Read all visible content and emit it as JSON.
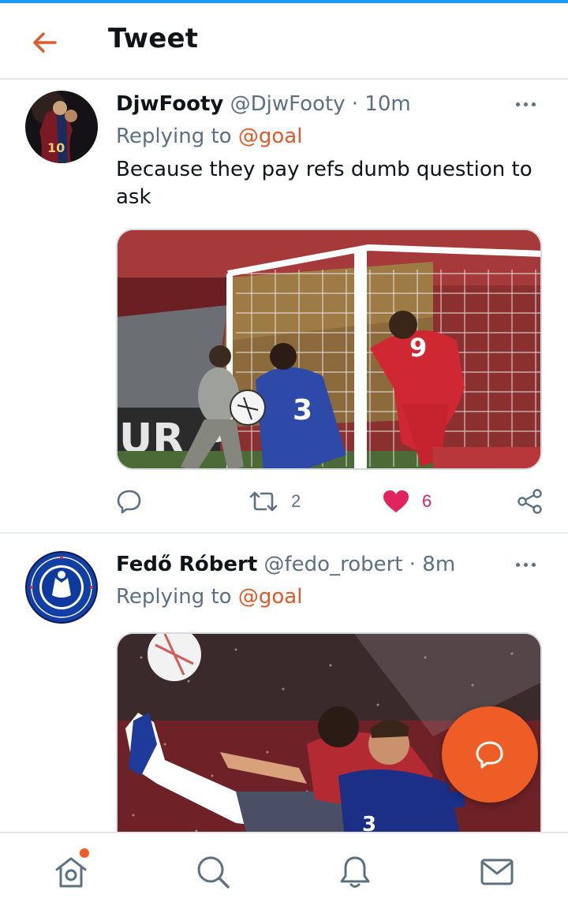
{
  "header": {
    "title": "Tweet"
  },
  "tweets": [
    {
      "name": "DjwFooty",
      "handle": "@DjwFooty",
      "separator": "·",
      "time": "10m",
      "replying_prefix": "Replying to",
      "replying_to": "@goal",
      "text": "Because they pay refs dumb question to ask",
      "media_alt": "Football match photo near goal net",
      "retweets": "2",
      "likes": "6",
      "liked": true
    },
    {
      "name": "Fedő Róbert",
      "handle": "@fedo_robert",
      "separator": "·",
      "time": "8m",
      "replying_prefix": "Replying to",
      "replying_to": "@goal",
      "media_alt": "Football players challenging in the rain"
    }
  ],
  "colors": {
    "accent": "#e0592a",
    "fab": "#ee5d25",
    "like": "#e0245e",
    "muted": "#5b7083"
  },
  "icons": {
    "back": "arrow-left-icon",
    "more": "more-horizontal-icon",
    "reply": "reply-icon",
    "retweet": "retweet-icon",
    "like": "heart-icon",
    "share": "share-icon",
    "compose": "compose-reply-icon",
    "nav": [
      "home-icon",
      "search-icon",
      "bell-icon",
      "mail-icon"
    ]
  }
}
